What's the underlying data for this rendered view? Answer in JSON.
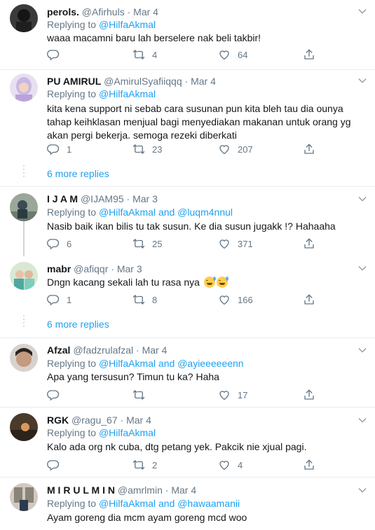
{
  "tweets": [
    {
      "name": "perols.",
      "handle": "@Afirhuls",
      "date": "Mar 4",
      "replying_label": "Replying to",
      "replying_to": "@HilfaAkmal",
      "text": "waaa macamni baru lah berselere nak beli takbir!",
      "replies": "",
      "retweets": "4",
      "likes": "64"
    },
    {
      "name": "PU AMIRUL",
      "handle": "@AmirulSyafiiqqq",
      "date": "Mar 4",
      "replying_label": "Replying to",
      "replying_to": "@HilfaAkmal",
      "text": "kita kena support ni sebab cara susunan pun kita bleh tau dia ounya tahap keihklasan menjual bagi menyediakan makanan untuk orang yg akan pergi bekerja. semoga rezeki diberkati",
      "replies": "1",
      "retweets": "23",
      "likes": "207"
    },
    {
      "name": "I J A M",
      "handle": "@IJAM95",
      "date": "Mar 3",
      "replying_label": "Replying to",
      "replying_to": "@HilfaAkmal and @luqm4nnul",
      "text": "Nasib baik ikan bilis tu tak susun. Ke dia susun jugakk !? Hahaaha",
      "replies": "6",
      "retweets": "25",
      "likes": "371"
    },
    {
      "name": "mabr",
      "handle": "@afiqqr",
      "date": "Mar 3",
      "text": "Dngn kacang sekali lah tu rasa nya",
      "replies": "1",
      "retweets": "8",
      "likes": "166"
    },
    {
      "name": "Afzal",
      "handle": "@fadzrulafzal",
      "date": "Mar 4",
      "replying_label": "Replying to",
      "replying_to": "@HilfaAkmal and @ayieeeeeenn",
      "text": "Apa yang tersusun? Timun tu ka? Haha",
      "replies": "",
      "retweets": "",
      "likes": "17"
    },
    {
      "name": "RGK",
      "handle": "@ragu_67",
      "date": "Mar 4",
      "replying_label": "Replying to",
      "replying_to": "@HilfaAkmal",
      "text": "Kalo ada org nk cuba, dtg petang yek. Pakcik nie xjual pagi.",
      "replies": "",
      "retweets": "2",
      "likes": "4"
    },
    {
      "name": "M I R U L M I N",
      "handle": "@amrlmin",
      "date": "Mar 4",
      "replying_label": "Replying to",
      "replying_to": "@HilfaAkmal and @hawaamanii",
      "text": "Ayam goreng dia mcm ayam goreng mcd woo"
    }
  ],
  "more_replies": [
    "6 more replies",
    "6 more replies"
  ],
  "dot": "·",
  "icons": {
    "reply": "reply-icon",
    "retweet": "retweet-icon",
    "like": "heart-icon",
    "share": "share-icon",
    "more": "chevron-down-icon"
  },
  "colors": {
    "link": "#1da1f2",
    "muted": "#657786",
    "divider": "#e6ecf0"
  }
}
